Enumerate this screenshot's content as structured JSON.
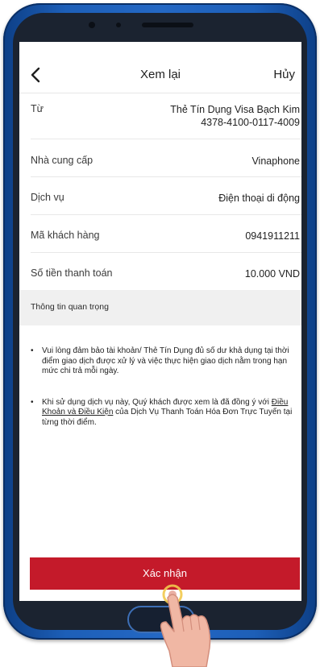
{
  "header": {
    "title": "Xem lại",
    "cancel_label": "Hủy"
  },
  "details": {
    "from_label": "Từ",
    "from_value_line1": "Thẻ Tín Dụng Visa Bạch Kim",
    "from_value_line2": "4378-4100-0117-4009",
    "provider_label": "Nhà cung cấp",
    "provider_value": "Vinaphone",
    "service_label": "Dịch vụ",
    "service_value": "Điện thoại di động",
    "customer_code_label": "Mã khách hàng",
    "customer_code_value": "0941911211",
    "amount_label": "Số tiền thanh toán",
    "amount_value": "10.000 VND"
  },
  "important": {
    "title": "Thông tin quan trọng",
    "note1": "Vui lòng đảm bảo tài khoản/ Thẻ Tín Dụng đủ số dư khả dụng tại thời điểm giao dịch được xử lý và việc thực hiện giao dịch nằm trong hạn mức chi trả mỗi ngày.",
    "note2_before": "Khi sử dụng dịch vụ này, Quý khách được xem là đã đồng ý với ",
    "note2_link": "Điều Khoản và Điều Kiện",
    "note2_after": " của Dịch Vụ Thanh Toán Hóa Đơn Trực Tuyến tại từng thời điểm."
  },
  "footer": {
    "confirm_label": "Xác nhận"
  },
  "colors": {
    "accent": "#c41a2a",
    "frame": "#1d5fb8"
  },
  "icons": {
    "back": "chevron-left-icon",
    "pointer": "tap-hand-icon"
  }
}
